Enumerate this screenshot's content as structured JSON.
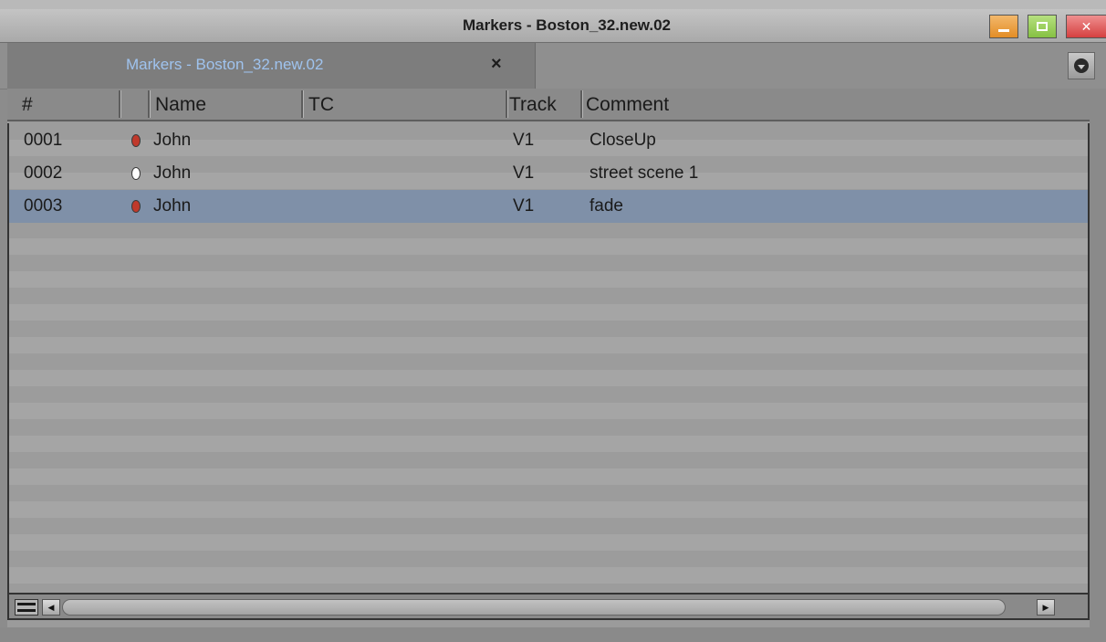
{
  "window": {
    "title": "Markers - Boston_32.new.02",
    "buttons": {
      "minimize": "minimize",
      "maximize": "maximize",
      "close": "✕"
    }
  },
  "tab": {
    "label": "Markers - Boston_32.new.02",
    "close": "×"
  },
  "table": {
    "columns": {
      "number": "#",
      "name": "Name",
      "tc": "TC",
      "track": "Track",
      "comment": "Comment"
    },
    "rows": [
      {
        "number": "0001",
        "color": "#c0392b",
        "name": "John",
        "tc": "",
        "track": "V1",
        "comment": "CloseUp",
        "selected": false
      },
      {
        "number": "0002",
        "color": "#ffffff",
        "name": "John",
        "tc": "",
        "track": "V1",
        "comment": "street scene 1",
        "selected": false
      },
      {
        "number": "0003",
        "color": "#c0392b",
        "name": "John",
        "tc": "",
        "track": "V1",
        "comment": "fade",
        "selected": true
      }
    ]
  },
  "colors": {
    "selection": "#7f90a8",
    "tab_label": "#9fc3ee"
  }
}
